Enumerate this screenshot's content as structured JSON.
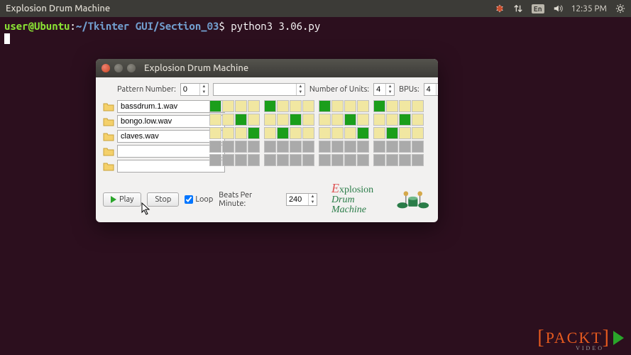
{
  "panel": {
    "app_title": "Explosion Drum Machine",
    "time": "12:35 PM",
    "keyboard": "En"
  },
  "terminal": {
    "user": "user@Ubuntu",
    "path": "~/Tkinter GUI/Section_03",
    "command": "python3 3.06.py"
  },
  "window": {
    "title": "Explosion Drum Machine"
  },
  "controls": {
    "pattern_label": "Pattern Number:",
    "pattern_value": "0",
    "pattern_name": "",
    "units_label": "Number of Units:",
    "units_value": "4",
    "bpus_label": "BPUs:",
    "bpus_value": "4"
  },
  "tracks": [
    {
      "file": "bassdrum.1.wav"
    },
    {
      "file": "bongo.low.wav"
    },
    {
      "file": "claves.wav"
    },
    {
      "file": ""
    },
    {
      "file": ""
    }
  ],
  "sequencer": {
    "rows": [
      [
        "g",
        "y",
        "y",
        "y",
        "g",
        "y",
        "y",
        "y",
        "g",
        "y",
        "y",
        "y",
        "g",
        "y",
        "y",
        "y"
      ],
      [
        "y",
        "y",
        "g",
        "y",
        "y",
        "y",
        "g",
        "y",
        "y",
        "y",
        "g",
        "y",
        "y",
        "y",
        "g",
        "y"
      ],
      [
        "y",
        "y",
        "y",
        "g",
        "y",
        "g",
        "y",
        "y",
        "y",
        "y",
        "y",
        "g",
        "y",
        "g",
        "y",
        "y"
      ],
      [
        "s",
        "s",
        "s",
        "s",
        "s",
        "s",
        "s",
        "s",
        "s",
        "s",
        "s",
        "s",
        "s",
        "s",
        "s",
        "s"
      ],
      [
        "s",
        "s",
        "s",
        "s",
        "s",
        "s",
        "s",
        "s",
        "s",
        "s",
        "s",
        "s",
        "s",
        "s",
        "s",
        "s"
      ]
    ]
  },
  "transport": {
    "play": "Play",
    "stop": "Stop",
    "loop_label": "Loop",
    "loop_checked": true,
    "bpm_label": "Beats Per Minute:",
    "bpm_value": "240"
  },
  "logo": {
    "line1_prefix": "E",
    "line1_rest": "xplosion",
    "line2": "Drum Machine"
  },
  "watermark": {
    "text": "PACKT",
    "sub": "VIDEO"
  }
}
